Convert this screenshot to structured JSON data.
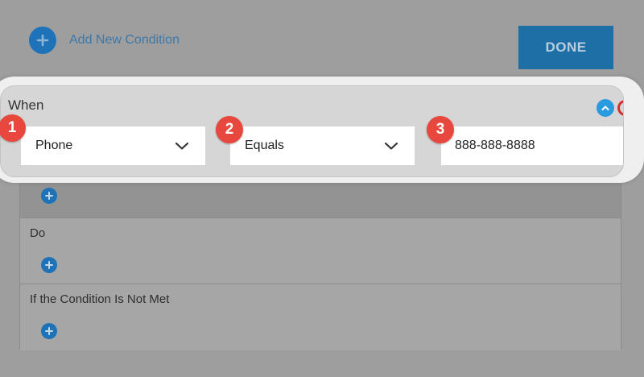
{
  "toolbar": {
    "add_new_label": "Add New Condition",
    "done_label": "DONE"
  },
  "when": {
    "label": "When",
    "field": {
      "value": "Phone"
    },
    "operator": {
      "value": "Equals"
    },
    "comparison": {
      "value": "888-888-8888"
    }
  },
  "do_section": {
    "label": "Do"
  },
  "not_met_section": {
    "label": "If the Condition Is Not Met"
  },
  "badges": [
    "1",
    "2",
    "3"
  ],
  "colors": {
    "accent_blue": "#1e73b8",
    "collapse_blue": "#2b9be0",
    "badge_red": "#e8473d",
    "done_button": "#1e6fa6",
    "overlay_dim": "#9e9e9e"
  },
  "icons": {
    "add": "plus-circle-icon",
    "collapse": "chevron-up-circle-icon",
    "dropdown": "chevron-down-icon"
  }
}
